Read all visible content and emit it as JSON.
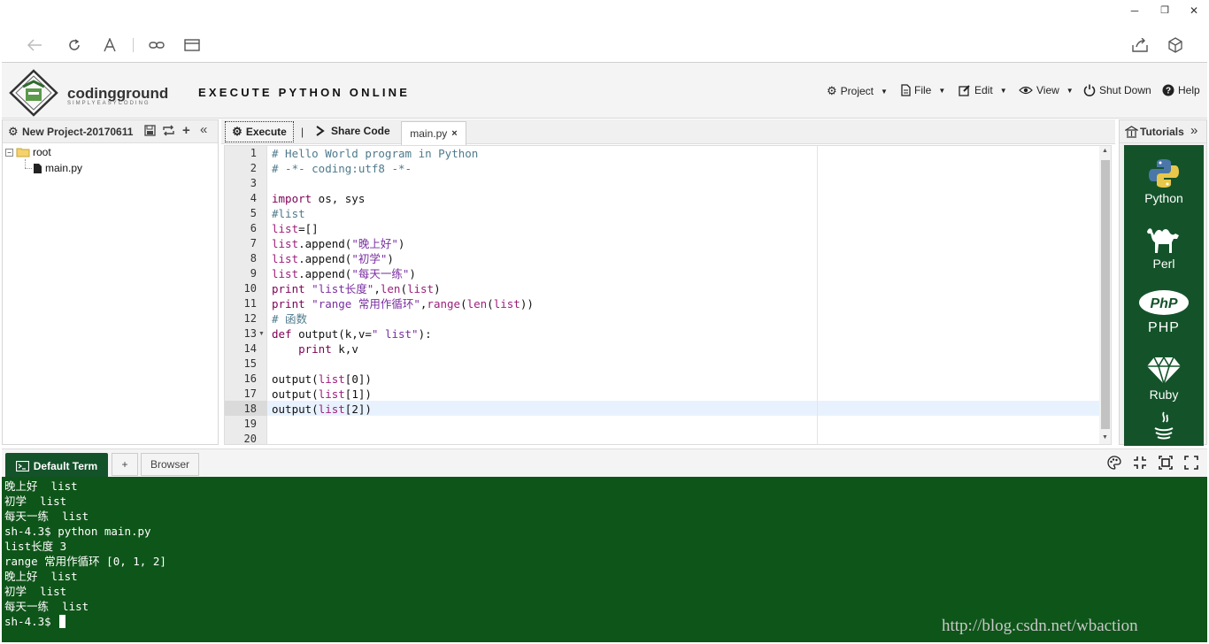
{
  "window": {
    "minimize": "─",
    "restore": "❐",
    "close": "✕"
  },
  "browser_toolbar": {
    "icons": [
      "back-icon",
      "refresh-icon",
      "reader-icon",
      "link-icon",
      "reading-list-icon",
      "share-icon",
      "extension-icon"
    ]
  },
  "header": {
    "brand": "codingground",
    "brand_sub": "SIMPLYEASYCODING",
    "tagline": "EXECUTE PYTHON ONLINE",
    "menu": [
      {
        "label": "Project",
        "icon": "gear-icon"
      },
      {
        "label": "File",
        "icon": "file-icon"
      },
      {
        "label": "Edit",
        "icon": "edit-icon"
      },
      {
        "label": "View",
        "icon": "eye-icon"
      },
      {
        "label": "Shut Down",
        "icon": "power-icon"
      },
      {
        "label": "Help",
        "icon": "help-icon"
      }
    ]
  },
  "project": {
    "title": "New Project-20170611",
    "tree": {
      "root": "root",
      "file": "main.py"
    }
  },
  "editor_toolbar": {
    "execute": "Execute",
    "separator": "|",
    "share": "Share Code",
    "tab": "main.py",
    "tab_close": "×"
  },
  "code": {
    "line_numbers": [
      "1",
      "2",
      "3",
      "4",
      "5",
      "6",
      "7",
      "8",
      "9",
      "10",
      "11",
      "12",
      "13",
      "14",
      "15",
      "16",
      "17",
      "18",
      "19",
      "20"
    ],
    "active_line": 18
  },
  "tutorials": {
    "title": "Tutorials",
    "items": [
      "Python",
      "Perl",
      "PHP",
      "Ruby"
    ]
  },
  "terminal_tabs": {
    "default": "Default Term",
    "plus": "+",
    "browser": "Browser"
  },
  "terminal": {
    "lines": [
      "晚上好  list",
      "初学  list",
      "每天一练  list",
      "sh-4.3$ python main.py",
      "list长度 3",
      "range 常用作循环 [0, 1, 2]",
      "晚上好  list",
      "初学  list",
      "每天一练  list",
      "sh-4.3$ "
    ]
  },
  "watermark": "http://blog.csdn.net/wbaction"
}
